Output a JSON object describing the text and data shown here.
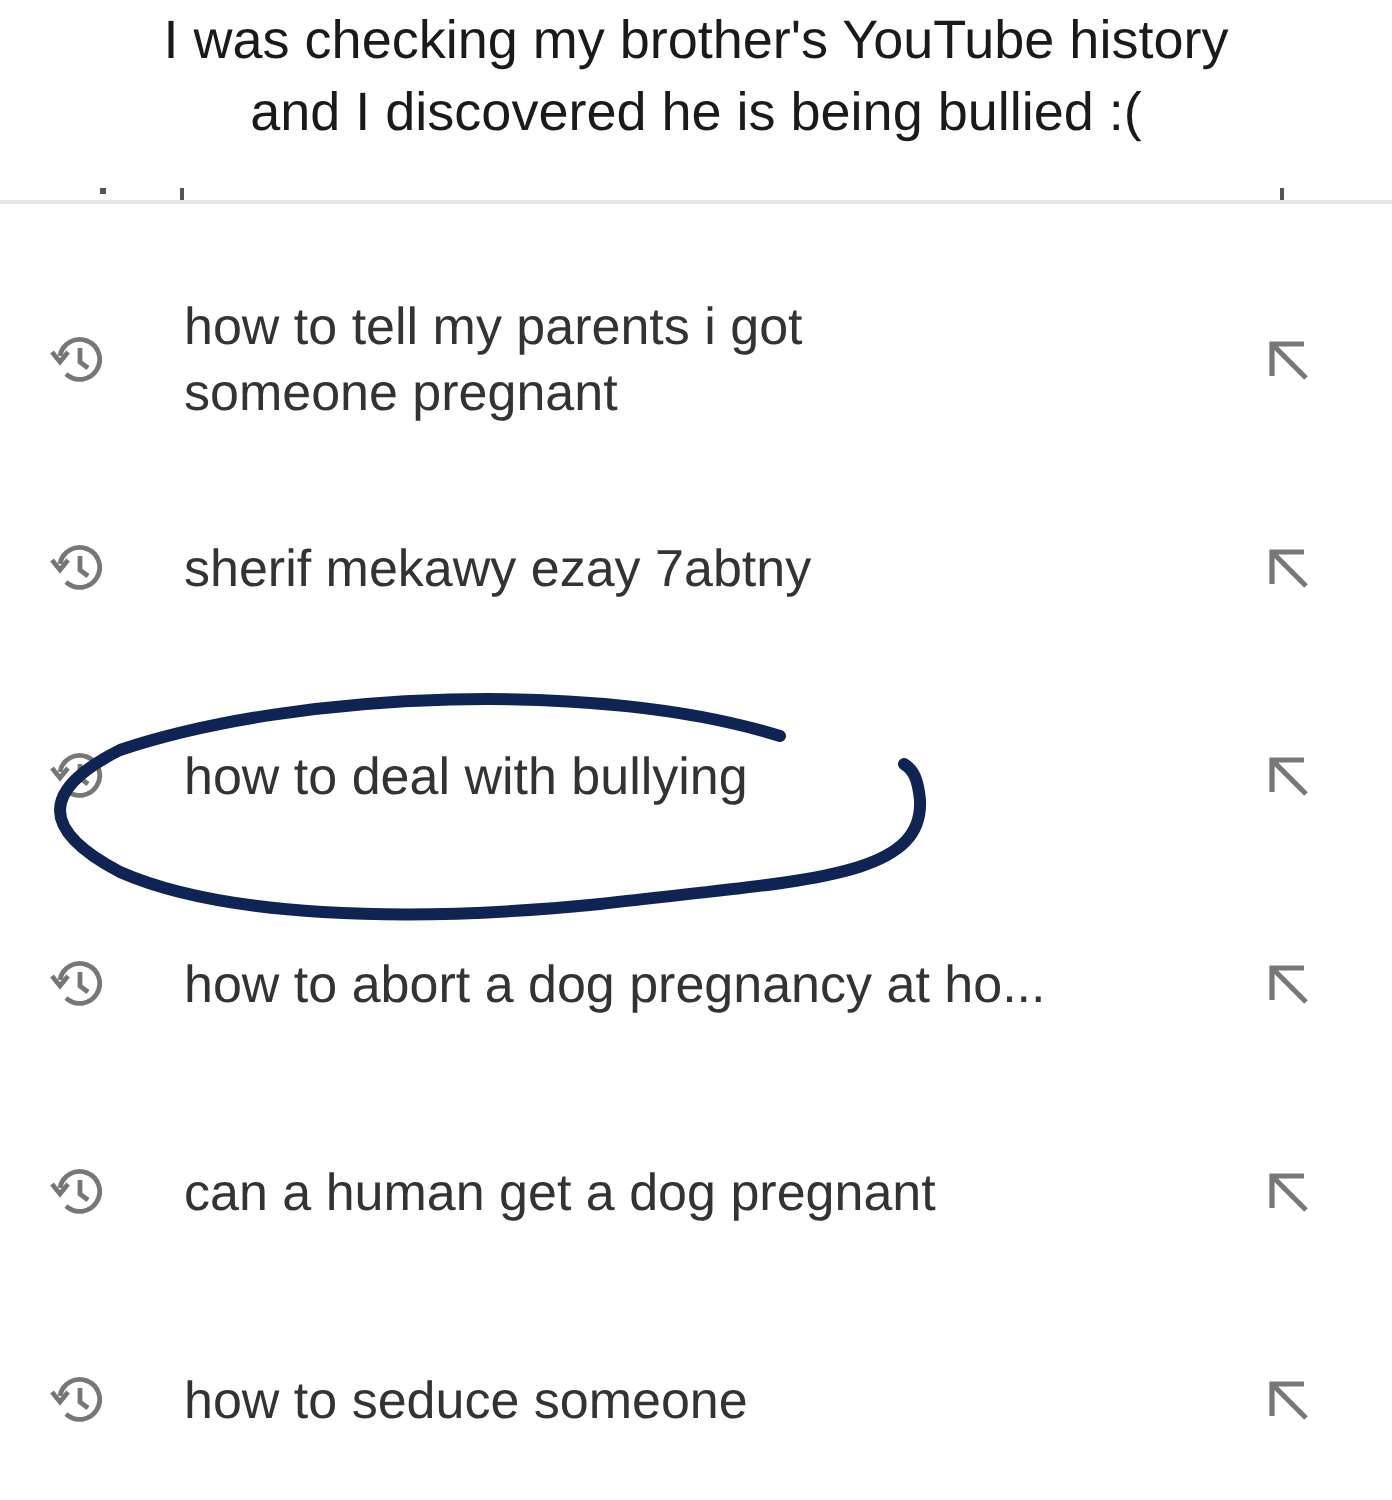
{
  "caption": [
    "I was checking my brother's YouTube history",
    "and I discovered he is being bullied :("
  ],
  "history": [
    {
      "lines": [
        "how to tell my parents i got",
        "someone pregnant"
      ],
      "circled": false
    },
    {
      "text": "sherif mekawy ezay 7abtny",
      "circled": false
    },
    {
      "text": "how to deal with bullying",
      "circled": true
    },
    {
      "text": "how to abort a dog pregnancy at ho...",
      "circled": false
    },
    {
      "text": "can a human get a dog pregnant",
      "circled": false
    },
    {
      "text": "how to seduce someone",
      "circled": false
    }
  ]
}
